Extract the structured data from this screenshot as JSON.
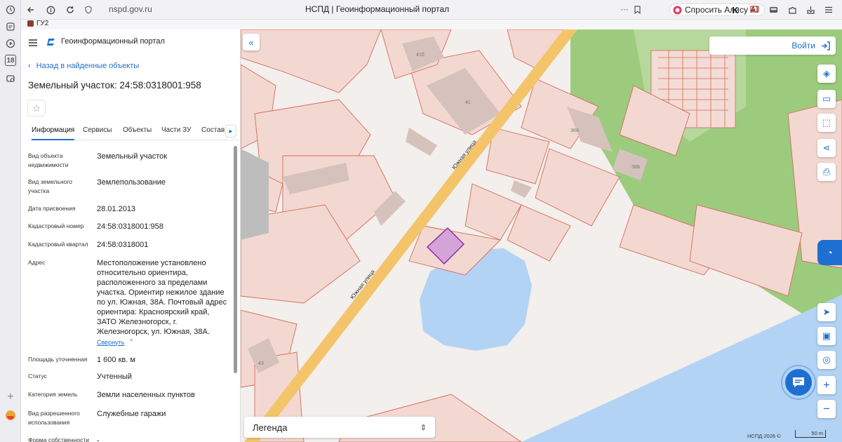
{
  "browser": {
    "url": "nspd.gov.ru",
    "page_title": "НСПД | Геоинформационный портал",
    "alice_button": "Спросить Алису AI",
    "bookmark": "ГУ2",
    "vtab_calendar_day": "18"
  },
  "header": {
    "portal_title": "Геоинформационный портал"
  },
  "panel": {
    "back_link": "Назад в найденные объекты",
    "object_title": "Земельный участок: 24:58:0318001:958",
    "tabs": [
      "Информация",
      "Сервисы",
      "Объекты",
      "Части ЗУ",
      "Состав"
    ],
    "active_tab": "Информация",
    "fields": [
      {
        "label": "Вид объекта недвижимости",
        "value": "Земельный участок"
      },
      {
        "label": "Вид земельного участка",
        "value": "Землепользование"
      },
      {
        "label": "Дата присвоения",
        "value": "28.01.2013"
      },
      {
        "label": "Кадастровый номер",
        "value": "24:58:0318001:958"
      },
      {
        "label": "Кадастровый квартал",
        "value": "24:58:0318001"
      },
      {
        "label": "Адрес",
        "value": "Местоположение установлено относительно ориентира, расположенного за пределами участка. Ориентир нежилое здание по ул. Южная, 38А. Почтовый адрес ориентира: Красноярский край, ЗАТО Железногорск, г. Железногорск, ул. Южная, 38А."
      },
      {
        "label": "Площадь уточненная",
        "value": "1 600 кв. м"
      },
      {
        "label": "Статус",
        "value": "Учтенный"
      },
      {
        "label": "Категория земель",
        "value": "Земли населенных пунктов"
      },
      {
        "label": "Вид разрешенного использования",
        "value": "Служебные гаражи"
      },
      {
        "label": "Форма собственности",
        "value": "-"
      }
    ],
    "collapse_link": "Свернуть"
  },
  "map": {
    "login_button": "Войти",
    "legend_label": "Легенда",
    "copyright": "НСПД 2026 ©",
    "scale": "50 m",
    "street_label": "Южная улица",
    "building_labels": [
      "41б",
      "41",
      "38А",
      "38Б",
      "43"
    ],
    "colors": {
      "parcel_fill": "#f3d8d1",
      "parcel_stroke": "#d56a58",
      "road": "#f4c46a",
      "water": "#b3d3f5",
      "forest": "#9ccb7d",
      "building": "#d6c2bd",
      "selected": "#d4a4d8",
      "selected_stroke": "#8a2a9a",
      "accent": "#1e6fd1"
    }
  }
}
